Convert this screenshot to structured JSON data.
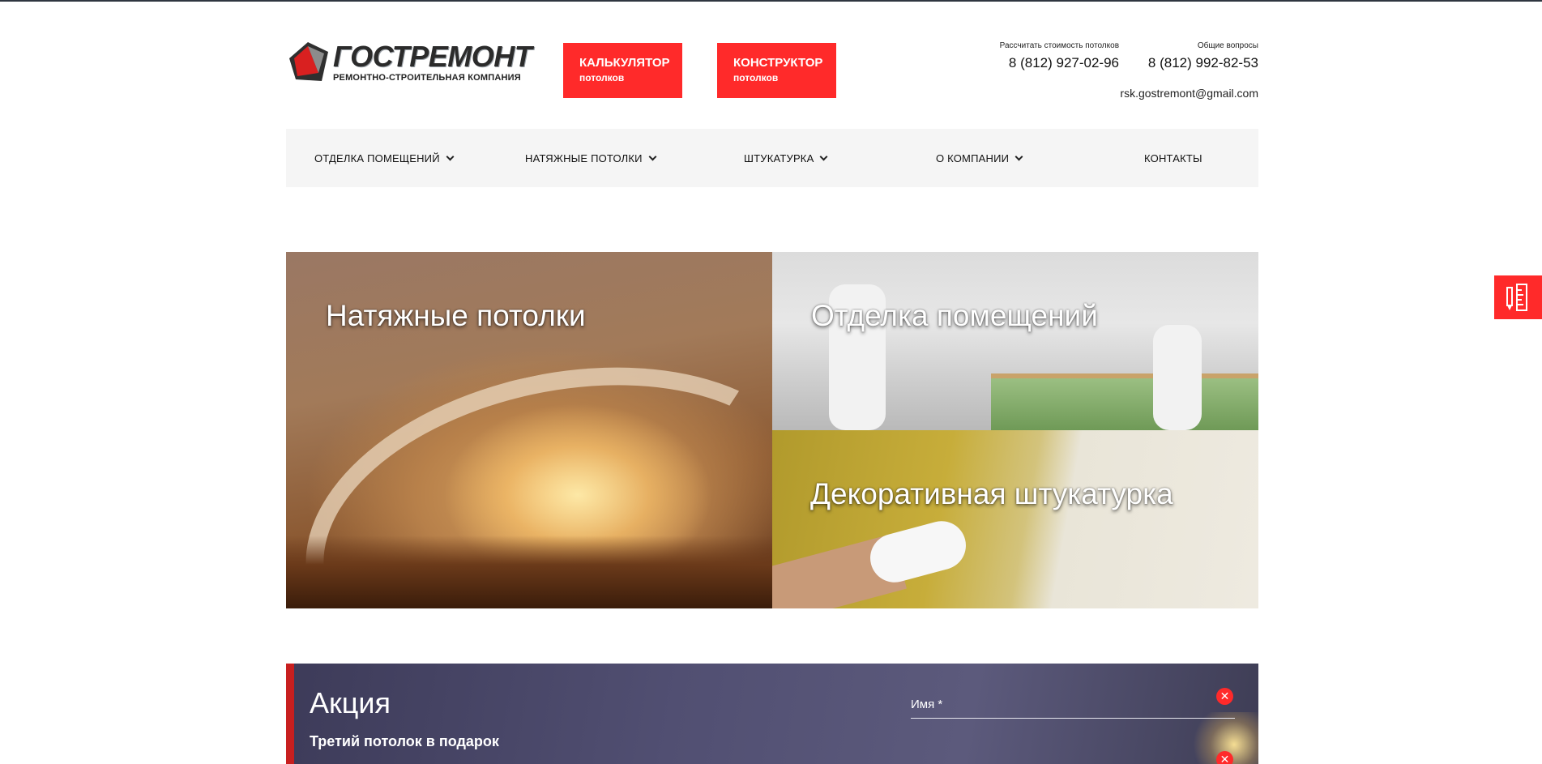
{
  "logo": {
    "title": "ГОСТРЕМОНТ",
    "subtitle": "РЕМОНТНО-СТРОИТЕЛЬНАЯ КОМПАНИЯ"
  },
  "cta": [
    {
      "title": "КАЛЬКУЛЯТОР",
      "subtitle": "потолков"
    },
    {
      "title": "КОНСТРУКТОР",
      "subtitle": "потолков"
    }
  ],
  "contacts": {
    "phone1_caption": "Рассчитать стоимость потолков",
    "phone1": "8 (812) 927-02-96",
    "phone2_caption": "Общие вопросы",
    "phone2": "8 (812) 992-82-53",
    "email": "rsk.gostremont@gmail.com"
  },
  "nav": [
    {
      "label": "ОТДЕЛКА ПОМЕЩЕНИЙ",
      "dropdown": true
    },
    {
      "label": "НАТЯЖНЫЕ ПОТОЛКИ",
      "dropdown": true
    },
    {
      "label": "ШТУКАТУРКА",
      "dropdown": true
    },
    {
      "label": "О КОМПАНИИ",
      "dropdown": true
    },
    {
      "label": "КОНТАКТЫ",
      "dropdown": false
    }
  ],
  "tiles": [
    {
      "title": "Натяжные потолки"
    },
    {
      "title": "Отделка помещений"
    },
    {
      "title": "Декоративная штукатурка"
    }
  ],
  "promo": {
    "title": "Акция",
    "subtitle": "Третий потолок в подарок",
    "name_field_label": "Имя *"
  },
  "colors": {
    "accent": "#ff2a2a",
    "nav_bg": "#f5f5f5",
    "promo_bg": "#4f4d6e"
  }
}
